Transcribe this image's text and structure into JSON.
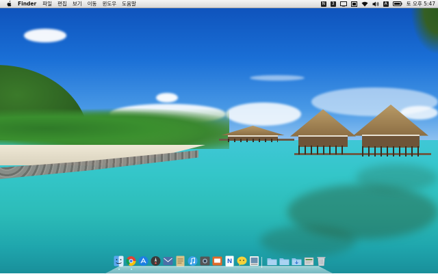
{
  "menubar": {
    "app_name": "Finder",
    "items": [
      "파일",
      "편집",
      "보기",
      "이동",
      "윈도우",
      "도움말"
    ],
    "clock": "토 오후 5:47",
    "status_icons": [
      "notes-menu-icon",
      "n-badge-icon",
      "display-icon",
      "screen-icon",
      "wifi-icon",
      "volume-icon",
      "input-source-icon",
      "battery-icon"
    ],
    "input_source_letter": "A",
    "badge_n_label": "N",
    "badge_3_label": "3"
  },
  "dock": {
    "items": [
      {
        "name": "finder-icon"
      },
      {
        "name": "chrome-icon"
      },
      {
        "name": "app-store-icon"
      },
      {
        "name": "launchpad-icon"
      },
      {
        "name": "mail-icon"
      },
      {
        "name": "notes-icon"
      },
      {
        "name": "itunes-icon"
      },
      {
        "name": "photo-icon"
      },
      {
        "name": "slides-icon"
      },
      {
        "name": "notepad-icon"
      },
      {
        "name": "messenger-icon"
      },
      {
        "name": "preview-icon"
      },
      {
        "name": "folder-apps-icon"
      },
      {
        "name": "folder-documents-icon"
      },
      {
        "name": "downloads-icon"
      },
      {
        "name": "stack-icon"
      },
      {
        "name": "trash-icon"
      }
    ]
  },
  "wallpaper": {
    "watermark": ""
  },
  "colors": {
    "menubar_bg": "#e6e6e6",
    "sea": "#2cbcb8",
    "sky": "#1a6fd6"
  }
}
